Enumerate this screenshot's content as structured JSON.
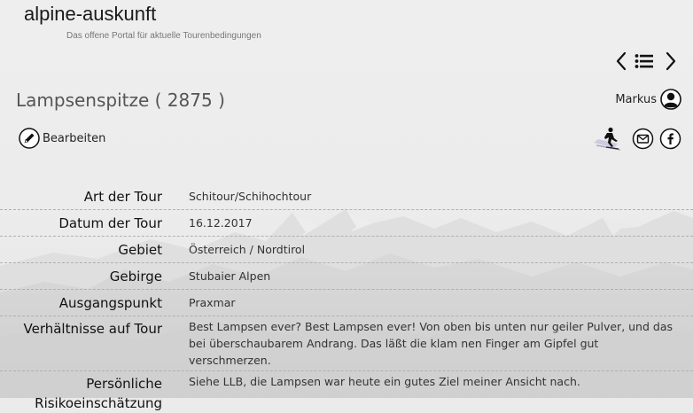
{
  "site": {
    "title": "alpine-auskunft",
    "subtitle": "Das offene Portal für aktuelle Tourenbedingungen"
  },
  "nav": {
    "prev_icon": "chevron-left-icon",
    "list_icon": "list-icon",
    "next_icon": "chevron-right-icon"
  },
  "page": {
    "title": "Lampsenspitze ( 2875 )"
  },
  "user": {
    "name": "Markus",
    "icon": "user-avatar-icon"
  },
  "edit": {
    "label": "Bearbeiten",
    "icon": "pencil-icon"
  },
  "actions": {
    "skier_icon": "skier-icon",
    "mail_icon": "mail-icon",
    "facebook_icon": "facebook-icon"
  },
  "details": [
    {
      "label": "Art der Tour",
      "value": "Schitour/Schihochtour"
    },
    {
      "label": "Datum der Tour",
      "value": "16.12.2017"
    },
    {
      "label": "Gebiet",
      "value": "Österreich / Nordtirol"
    },
    {
      "label": "Gebirge",
      "value": "Stubaier Alpen"
    },
    {
      "label": "Ausgangspunkt",
      "value": "Praxmar"
    },
    {
      "label": "Verhältnisse auf Tour",
      "value": "Best Lampsen ever? Best Lampsen ever! Von oben bis unten nur geiler Pulver, und das bei überschaubarem Andrang. Das läßt die klam nen Finger am Gipfel gut verschmerzen."
    },
    {
      "label": "Persönliche Risikoeinschätzung",
      "value": "Siehe LLB, die Lampsen war heute ein gutes Ziel meiner Ansicht nach."
    }
  ],
  "colors": {
    "background": "#ebebeb",
    "title_gray": "#555555",
    "divider": "#b0b0b0"
  }
}
